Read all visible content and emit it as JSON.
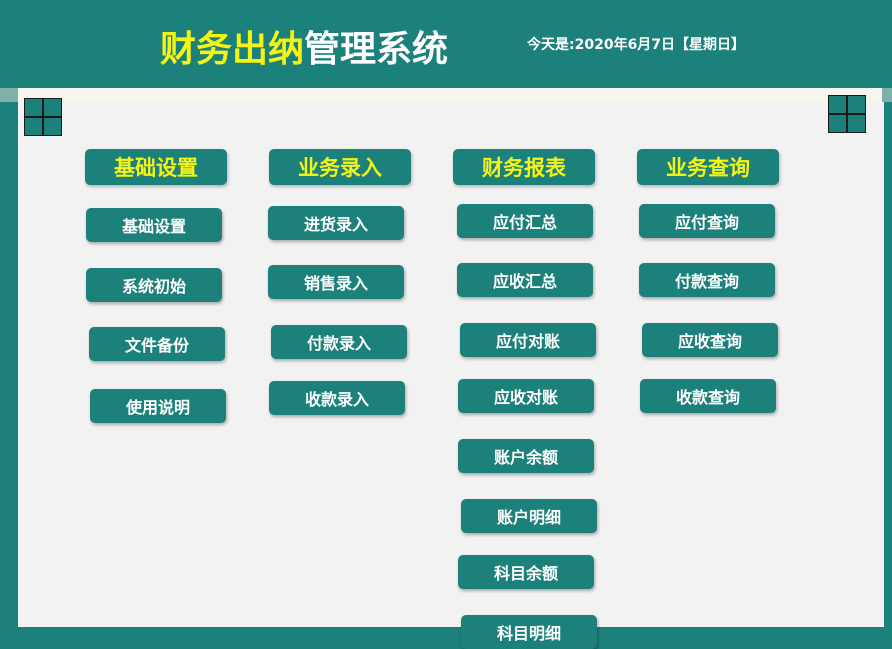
{
  "header": {
    "title_part1": "财务出纳",
    "title_part2": "管理系统",
    "date_text": "今天是:2020年6月7日【星期日】"
  },
  "icons": {
    "left": "grid-icon",
    "right": "grid-icon"
  },
  "colors": {
    "teal": "#1c807b",
    "yellow": "#f5f511",
    "background": "#f2f2f2"
  },
  "columns": [
    {
      "header": "基础设置",
      "buttons": [
        "基础设置",
        "系统初始",
        "文件备份",
        "使用说明"
      ]
    },
    {
      "header": "业务录入",
      "buttons": [
        "进货录入",
        "销售录入",
        "付款录入",
        "收款录入"
      ]
    },
    {
      "header": "财务报表",
      "buttons": [
        "应付汇总",
        "应收汇总",
        "应付对账",
        "应收对账",
        "账户余额",
        "账户明细",
        "科目余额",
        "科目明细"
      ]
    },
    {
      "header": "业务查询",
      "buttons": [
        "应付查询",
        "付款查询",
        "应收查询",
        "收款查询"
      ]
    }
  ]
}
